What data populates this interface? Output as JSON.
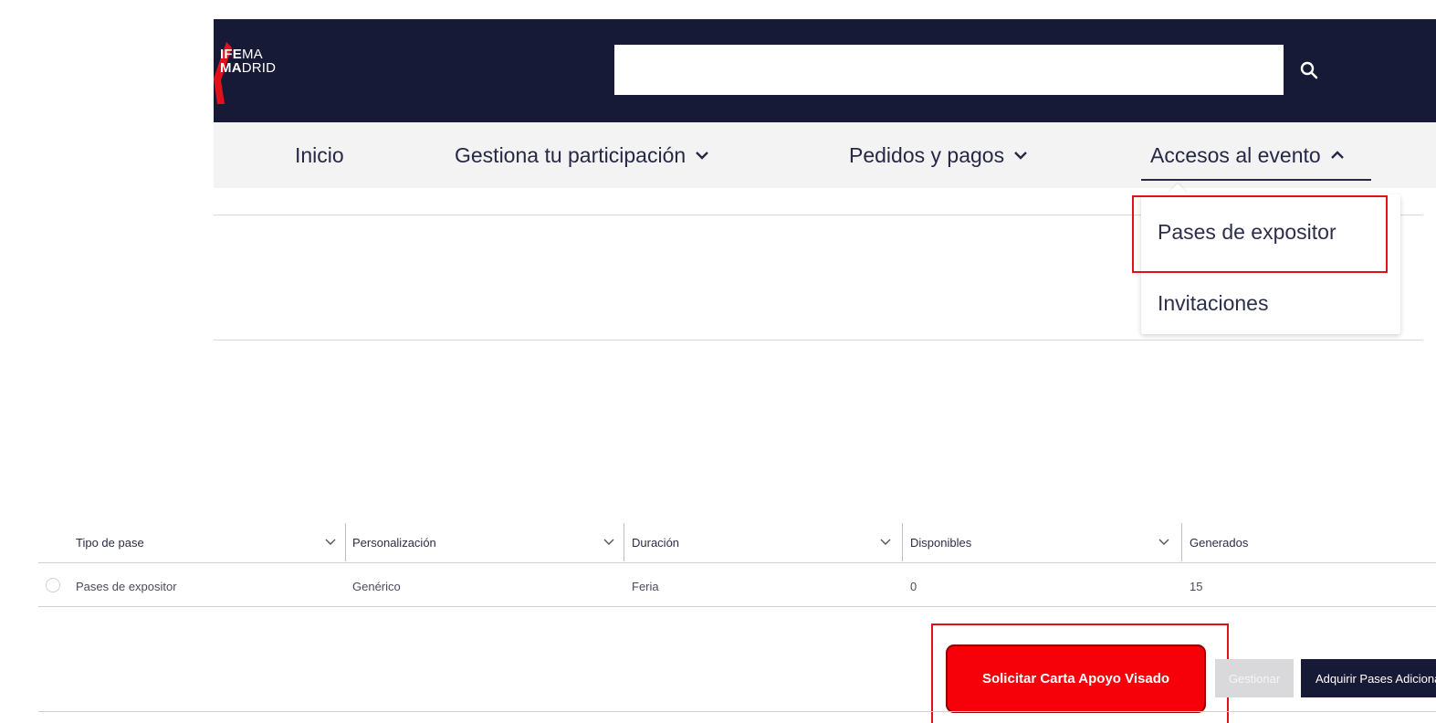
{
  "brand": {
    "line1_bold": "IFE",
    "line1_rest": "MA",
    "line2_bold": "MA",
    "line2_rest": "DRID",
    "accent": "#e3101b",
    "header_bg": "#171a36"
  },
  "search": {
    "value": "",
    "placeholder": ""
  },
  "nav": {
    "items": [
      {
        "label": "Inicio"
      },
      {
        "label": "Gestiona tu participación"
      },
      {
        "label": "Pedidos y pagos"
      },
      {
        "label": "Accesos al evento"
      }
    ]
  },
  "dropdown": {
    "items": [
      {
        "label": "Pases de expositor"
      },
      {
        "label": "Invitaciones"
      }
    ]
  },
  "table": {
    "headers": [
      "Tipo de pase",
      "Personalización",
      "Duración",
      "Disponibles",
      "Generados"
    ],
    "rows": [
      [
        "Pases de expositor",
        "Genérico",
        "Feria",
        "0",
        "15"
      ]
    ]
  },
  "actions": {
    "solicitar_label": "Solicitar Carta Apoyo Visado",
    "gestionar_label": "Gestionar",
    "adquirir_label": "Adquirir Pases Adicionales"
  }
}
